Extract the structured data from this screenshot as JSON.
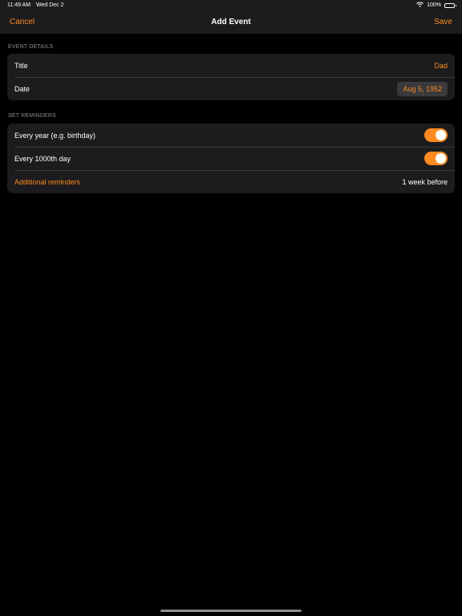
{
  "status_bar": {
    "time": "11:49 AM",
    "date": "Wed Dec 2",
    "battery": "100%"
  },
  "nav": {
    "cancel": "Cancel",
    "title": "Add Event",
    "save": "Save"
  },
  "event_details": {
    "header": "EVENT DETAILS",
    "title_label": "Title",
    "title_value": "Dad",
    "date_label": "Date",
    "date_value": "Aug 5, 1952"
  },
  "reminders": {
    "header": "SET REMINDERS",
    "every_year_label": "Every year (e.g. birthday)",
    "every_year_on": true,
    "every_1000_label": "Every 1000th day",
    "every_1000_on": true,
    "additional_label": "Additional reminders",
    "additional_value": "1 week before"
  },
  "colors": {
    "accent": "#ff8a1f",
    "background": "#000000",
    "card": "#1c1c1e"
  }
}
